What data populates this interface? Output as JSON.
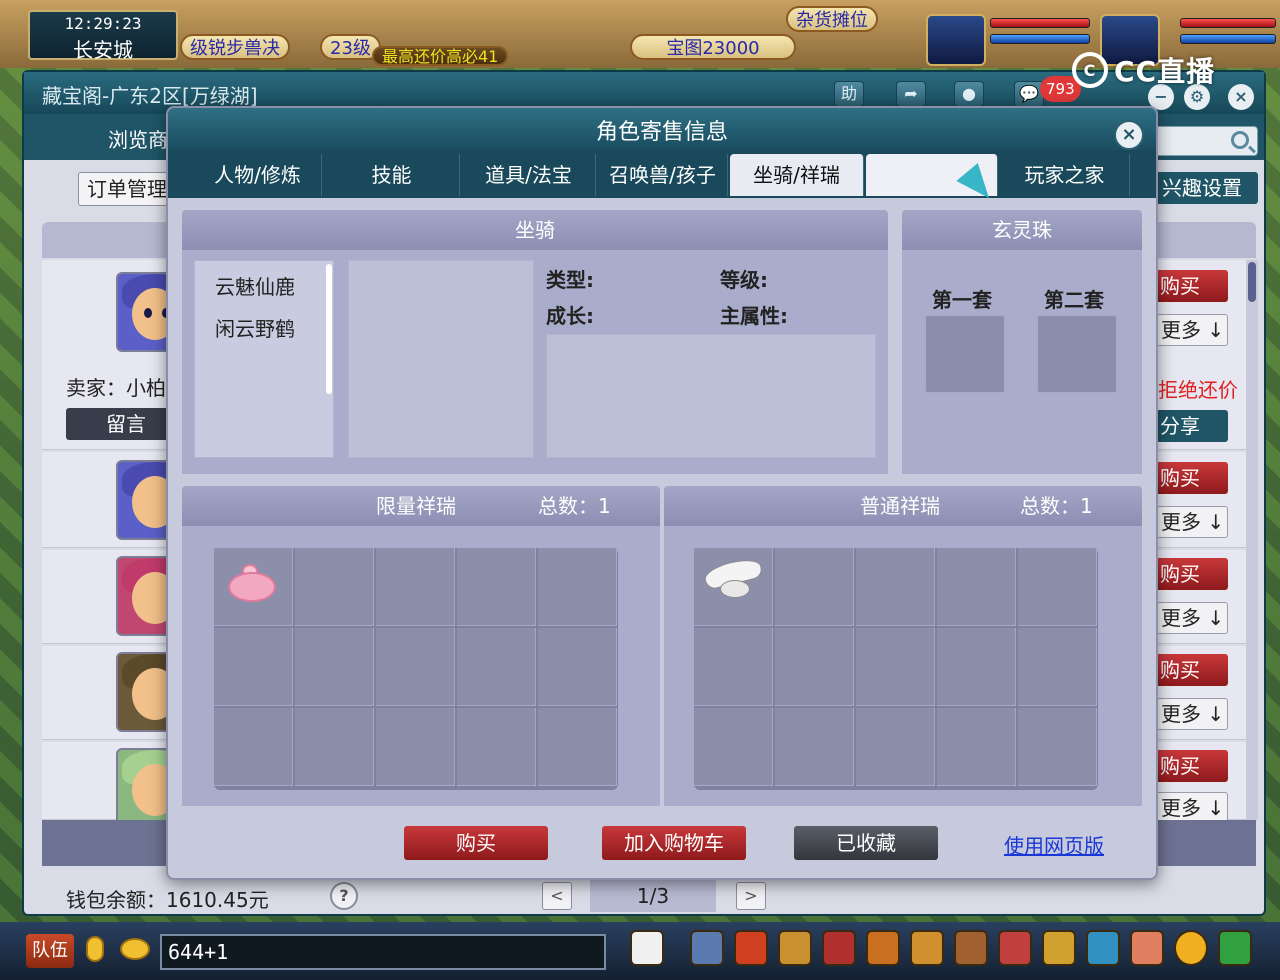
{
  "hud": {
    "time": "12:29:23",
    "location": "长安城",
    "quest_1": "级锐步兽决",
    "quest_2": "23级",
    "quest_3": "宝图23000",
    "quest_4": "杂货摊位",
    "quest_overlay": "最高还价高必41",
    "stream_logo": "CC直播"
  },
  "back_window": {
    "title": "藏宝阁-广东2区[万绿湖]",
    "toolbar_help": "助",
    "notification_count": "793",
    "nav_browse": "浏览商",
    "order_manage": "订单管理",
    "interest_settings": "兴趣设置",
    "seller_label": "卖家：小柏",
    "message_button": "留言",
    "buy_label": "购买",
    "more_label": "更多",
    "no_bargain": "拒绝还价",
    "share_label": "分享",
    "wallet": "钱包余额：1610.45元",
    "help_icon": "?",
    "prev_page": "<",
    "next_page": ">",
    "page_indicator": "1/3"
  },
  "modal": {
    "title": "角色寄售信息",
    "close_icon": "×",
    "tabs": [
      "人物/修炼",
      "技能",
      "道具/法宝",
      "召唤兽/孩子",
      "坐骑/祥瑞",
      "",
      "玩家之家"
    ],
    "active_tab": "坐骑/祥瑞",
    "mount_section": "坐骑",
    "mounts": [
      "云魅仙鹿",
      "闲云野鹤"
    ],
    "attr_type": "类型:",
    "attr_level": "等级:",
    "attr_growth": "成长:",
    "attr_main": "主属性:",
    "orb_section": "玄灵珠",
    "orb_set_1": "第一套",
    "orb_set_2": "第二套",
    "limited_section": "限量祥瑞",
    "limited_total": "总数：1",
    "normal_section": "普通祥瑞",
    "normal_total": "总数：1",
    "buy_button": "购买",
    "cart_button": "加入购物车",
    "favorited_button": "已收藏",
    "web_link": "使用网页版"
  },
  "bottom_bar": {
    "team_button": "队伍",
    "chat_text": "644+1"
  },
  "colors": {
    "teal_bar": "#1f5566",
    "modal_bg": "#c7c9dd",
    "red_button": "#c8383a",
    "link_blue": "#1838d8"
  }
}
